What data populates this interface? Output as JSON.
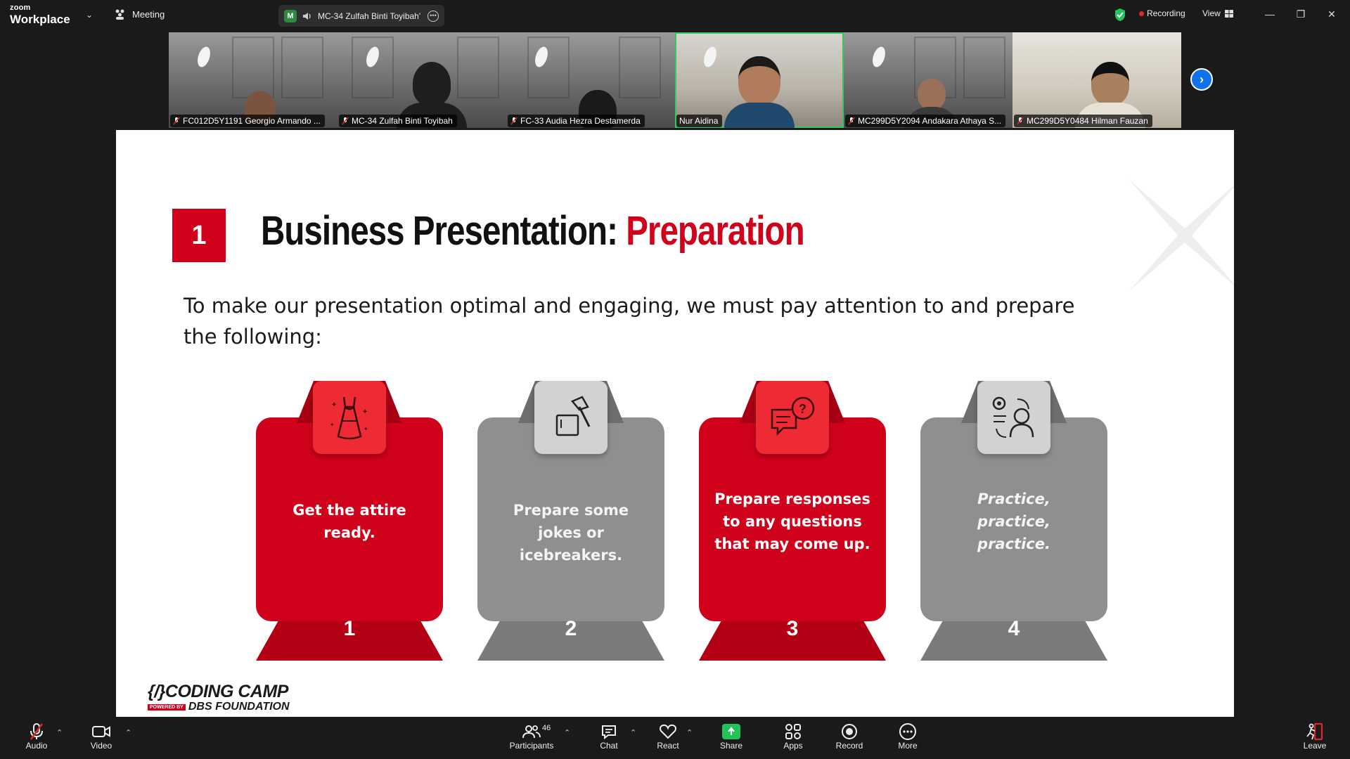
{
  "titlebar": {
    "brand_small": "zoom",
    "brand_large": "Workplace",
    "meeting_label": "Meeting",
    "speaker_badge": "M",
    "speaker_name": "MC-34 Zulfah Binti Toyibah'",
    "recording_label": "Recording",
    "view_label": "View"
  },
  "participants_strip": [
    {
      "name": "FC012D5Y1191 Georgio Armando ...",
      "muted": true
    },
    {
      "name": "MC-34 Zulfah Binti Toyibah",
      "muted": true
    },
    {
      "name": "FC-33 Audia Hezra Destamerda",
      "muted": true
    },
    {
      "name": "Nur Aidina",
      "muted": false
    },
    {
      "name": "MC299D5Y2094 Andakara Athaya S...",
      "muted": true
    },
    {
      "name": "MC299D5Y0484 Hilman Fauzan",
      "muted": true
    }
  ],
  "slide": {
    "number": "1",
    "title_main": "Business Presentation: ",
    "title_accent": "Preparation",
    "intro": "To make our presentation optimal and engaging, we must pay attention to and prepare the following:",
    "cards": [
      {
        "text": "Get the attire ready.",
        "num": "1",
        "icon": "dress-icon",
        "style": "red"
      },
      {
        "text": "Prepare some jokes or icebreakers.",
        "num": "2",
        "icon": "hammer-icon",
        "style": "grey"
      },
      {
        "text": "Prepare responses to any questions that may come up.",
        "num": "3",
        "icon": "question-chat-icon",
        "style": "red"
      },
      {
        "text": "Practice, practice, practice.",
        "num": "4",
        "icon": "practice-person-icon",
        "style": "grey"
      }
    ],
    "logo_line1": "CODING CAMP",
    "logo_powered": "POWERED BY",
    "logo_line2": "DBS FOUNDATION",
    "colors": {
      "accent": "#d0021b",
      "grey": "#8f8f8f"
    }
  },
  "toolbar": {
    "audio": "Audio",
    "video": "Video",
    "participants": "Participants",
    "participants_count": "46",
    "chat": "Chat",
    "react": "React",
    "share": "Share",
    "apps": "Apps",
    "record": "Record",
    "more": "More",
    "leave": "Leave"
  }
}
